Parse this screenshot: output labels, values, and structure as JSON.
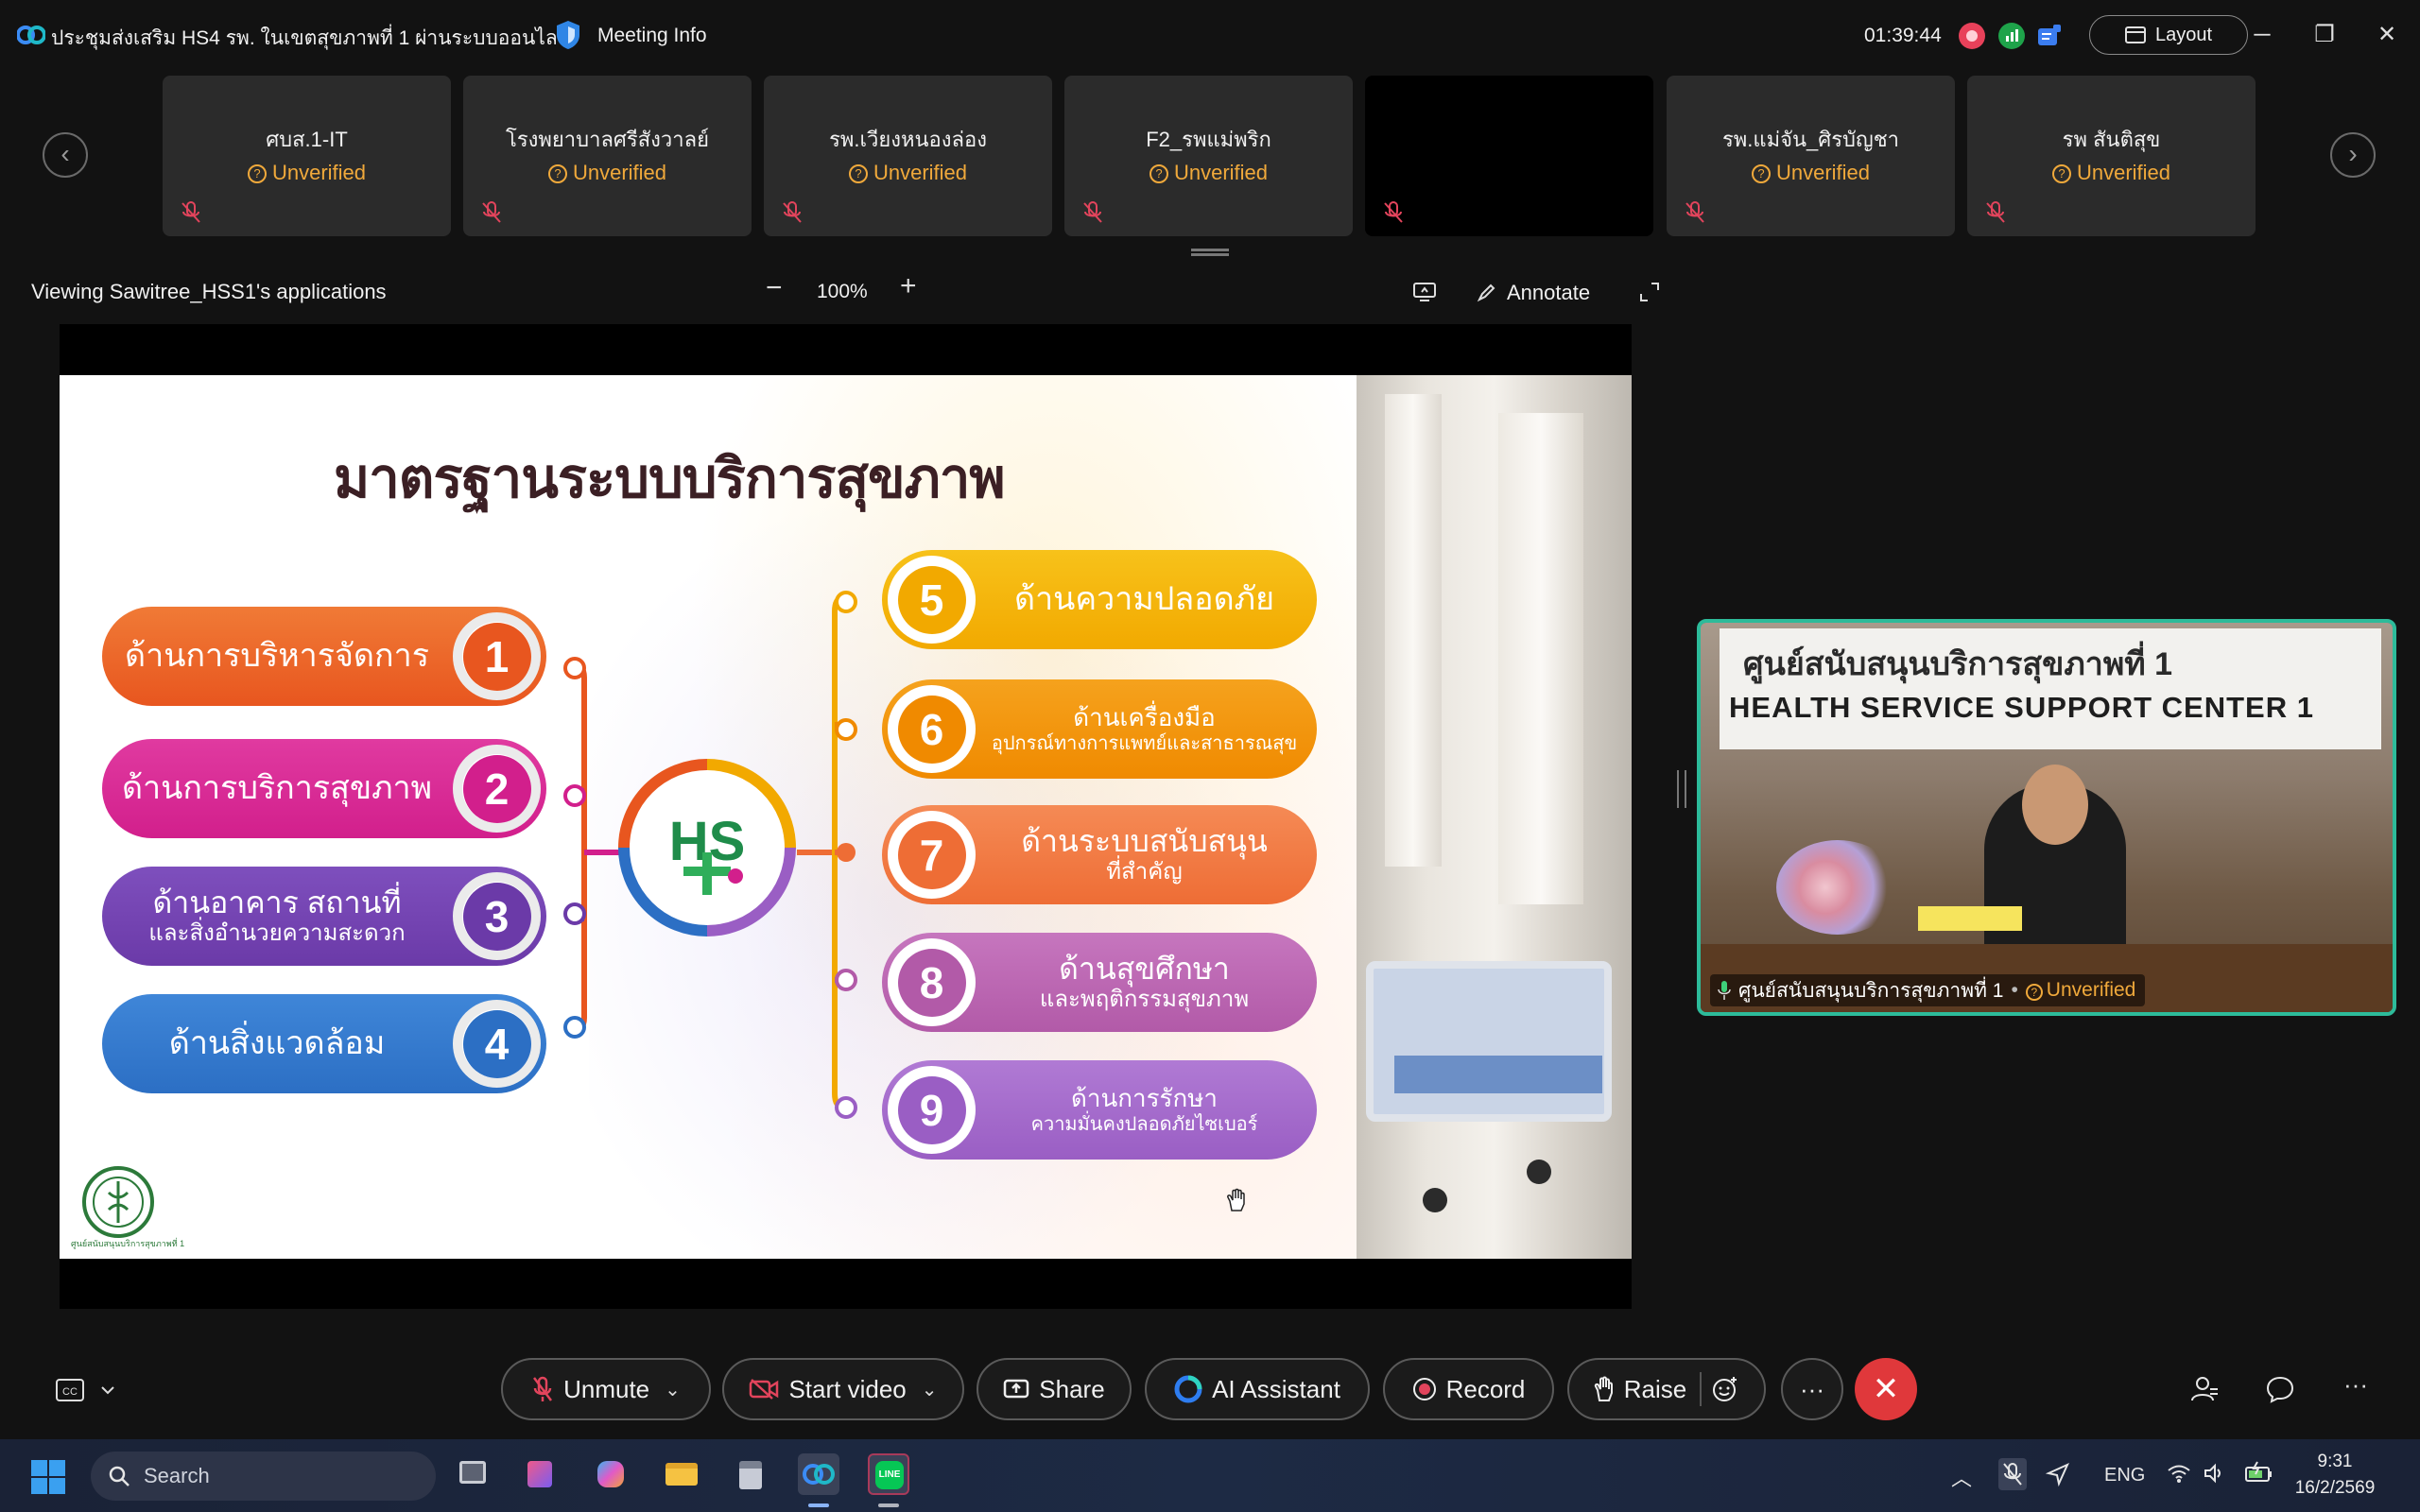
{
  "titlebar": {
    "meeting_title": "ประชุมส่งเสริม HS4 รพ. ในเขตสุขภาพที่ 1 ผ่านระบบออนไลน์",
    "meeting_info": "Meeting Info",
    "clock": "01:39:44",
    "layout_label": "Layout"
  },
  "participants": [
    {
      "name": "ศบส.1-IT",
      "status": "Unverified"
    },
    {
      "name": "โรงพยาบาลศรีสังวาลย์",
      "status": "Unverified"
    },
    {
      "name": "รพ.เวียงหนองล่อง",
      "status": "Unverified"
    },
    {
      "name": "F2_รพแม่พริก",
      "status": "Unverified"
    },
    {
      "name": "",
      "status": ""
    },
    {
      "name": "รพ.แม่จัน_ศิรบัญชา",
      "status": "Unverified"
    },
    {
      "name": "รพ สันติสุข",
      "status": "Unverified"
    }
  ],
  "share_bar": {
    "viewing": "Viewing Sawitree_HSS1's applications",
    "zoom_minus": "−",
    "zoom": "100%",
    "zoom_plus": "+",
    "annotate": "Annotate"
  },
  "slide": {
    "title": "มาตรฐานระบบบริการสุขภาพ",
    "left_items": [
      {
        "num": "1",
        "line1": "ด้านการบริหารจัดการ",
        "line2": "",
        "color": "#e8561f",
        "color2": "#f07a36"
      },
      {
        "num": "2",
        "line1": "ด้านการบริการสุขภาพ",
        "line2": "",
        "color": "#d21f8c",
        "color2": "#e03aa0"
      },
      {
        "num": "3",
        "line1": "ด้านอาคาร สถานที่",
        "line2": "และสิ่งอำนวยความสะดวก",
        "color": "#6b3aa8",
        "color2": "#7e4fbd"
      },
      {
        "num": "4",
        "line1": "ด้านสิ่งแวดล้อม",
        "line2": "",
        "color": "#2c6fc4",
        "color2": "#3f86d8"
      }
    ],
    "right_items": [
      {
        "num": "5",
        "line1": "ด้านความปลอดภัย",
        "line2": "",
        "color": "#f2a900",
        "color2": "#f7c21a"
      },
      {
        "num": "6",
        "line1": "ด้านเครื่องมือ",
        "line2": "อุปกรณ์ทางการแพทย์และสาธารณสุข",
        "color": "#f08a00",
        "color2": "#f5a21d"
      },
      {
        "num": "7",
        "line1": "ด้านระบบสนับสนุน",
        "line2": "ที่สำคัญ",
        "color": "#ee6d35",
        "color2": "#f58a55"
      },
      {
        "num": "8",
        "line1": "ด้านสุขศึกษา",
        "line2": "และพฤติกรรมสุขภาพ",
        "color": "#b25aa8",
        "color2": "#c676be"
      },
      {
        "num": "9",
        "line1": "ด้านการรักษา",
        "line2": "ความมั่นคงปลอดภัยไซเบอร์",
        "color": "#9a5ec4",
        "color2": "#b07ad4"
      }
    ],
    "center_logo": "HS",
    "moph_caption": "ศูนย์สนับสนุนบริการสุขภาพที่ 1"
  },
  "speaker": {
    "banner_th": "ศูนย์สนับสนุนบริการสุขภาพที่ 1",
    "banner_en": "HEALTH SERVICE SUPPORT CENTER 1",
    "name": "ศูนย์สนับสนุนบริการสุขภาพที่ 1",
    "status": "Unverified"
  },
  "controls": {
    "unmute": "Unmute",
    "start_video": "Start video",
    "share": "Share",
    "ai_assistant": "AI Assistant",
    "record": "Record",
    "raise": "Raise",
    "more": "···"
  },
  "taskbar": {
    "search": "Search",
    "lang": "ENG",
    "time": "9:31",
    "date": "16/2/2569"
  }
}
